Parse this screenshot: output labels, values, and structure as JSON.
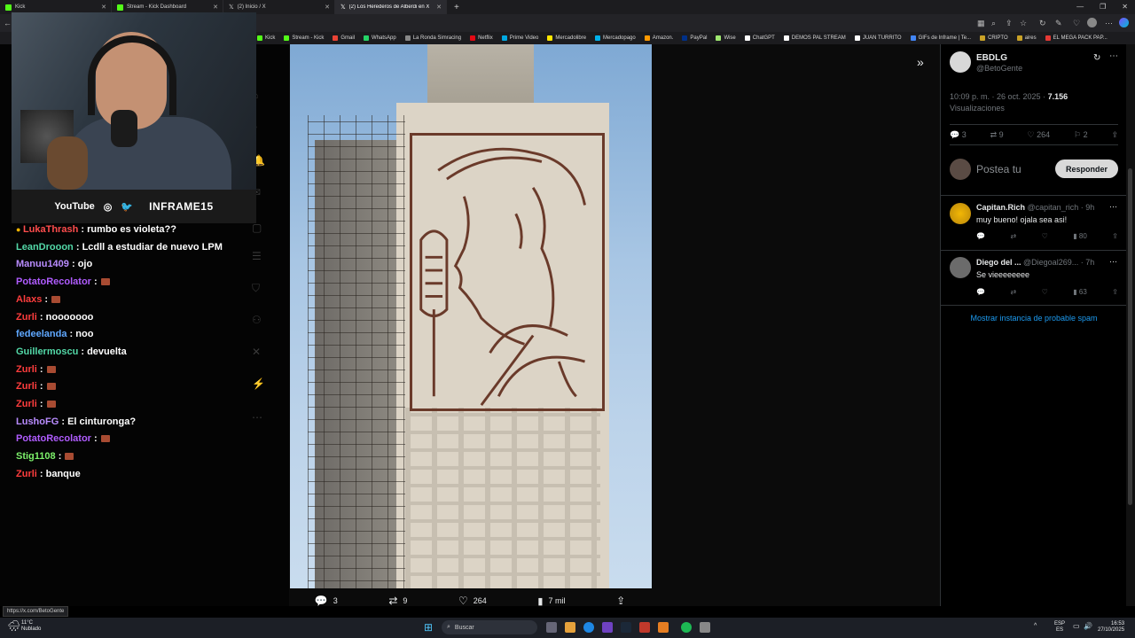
{
  "tabs": [
    {
      "label": "Kick",
      "color": "#53fc18"
    },
    {
      "label": "Stream - Kick Dashboard",
      "color": "#53fc18"
    },
    {
      "label": "(2) Inicio / X",
      "color": "#ffffff"
    },
    {
      "label": "(2) Los Herederos de Alberdi en X",
      "color": "#ffffff"
    }
  ],
  "new_tab": "+",
  "bookmarks": [
    {
      "label": "Kick",
      "color": "#53fc18"
    },
    {
      "label": "Stream - Kick",
      "color": "#53fc18"
    },
    {
      "label": "Gmail",
      "color": "#ea4335"
    },
    {
      "label": "WhatsApp",
      "color": "#25d366"
    },
    {
      "label": "La Ronda Simracing",
      "color": "#888888"
    },
    {
      "label": "Netflix",
      "color": "#e50914"
    },
    {
      "label": "Prime Video",
      "color": "#00a8e1"
    },
    {
      "label": "Mercadolibre",
      "color": "#ffe600"
    },
    {
      "label": "Mercadopago",
      "color": "#00b1ea"
    },
    {
      "label": "Amazon.",
      "color": "#ff9900"
    },
    {
      "label": "PayPal",
      "color": "#003087"
    },
    {
      "label": "Wise",
      "color": "#9fe870"
    },
    {
      "label": "ChatGPT",
      "color": "#ffffff"
    },
    {
      "label": "DEMOS PAL STREAM",
      "color": "#ffffff"
    },
    {
      "label": "JUAN TURRITO",
      "color": "#ffffff"
    },
    {
      "label": "GIFs de Inframe | Te...",
      "color": "#4285f4"
    },
    {
      "label": "CRIPTO",
      "color": "#c9a227"
    },
    {
      "label": "aires",
      "color": "#c9a227"
    },
    {
      "label": "EL MEGA PACK PAP...",
      "color": "#e53935"
    }
  ],
  "socialbar": {
    "youtube": "YouTube",
    "channel": "INFRAME15"
  },
  "chat": [
    {
      "user": "LukaThrash",
      "color": "#ff4d4d",
      "msg": ": rumbo es violeta??",
      "badge": true
    },
    {
      "user": "LeanDrooon",
      "color": "#53d9a8",
      "msg": ": Lcdll a estudiar de nuevo LPM"
    },
    {
      "user": "Manuu1409",
      "color": "#b98cff",
      "msg": ": ojo"
    },
    {
      "user": "PotatoRecolator",
      "color": "#b05cff",
      "msg": ":",
      "emote": true
    },
    {
      "user": "Alaxs",
      "color": "#ff3d3d",
      "msg": ":",
      "emote": true
    },
    {
      "user": "Zurli",
      "color": "#ff3d3d",
      "msg": ": nooooooo"
    },
    {
      "user": "fedeelanda",
      "color": "#5fa8ff",
      "msg": ": noo"
    },
    {
      "user": "Guillermoscu",
      "color": "#53d9a8",
      "msg": ": devuelta"
    },
    {
      "user": "Zurli",
      "color": "#ff3d3d",
      "msg": ":",
      "emote": true
    },
    {
      "user": "Zurli",
      "color": "#ff3d3d",
      "msg": ":",
      "emote": true
    },
    {
      "user": "Zurli",
      "color": "#ff3d3d",
      "msg": ":",
      "emote": true
    },
    {
      "user": "LushoFG",
      "color": "#b98cff",
      "msg": ": El cinturonga?"
    },
    {
      "user": "PotatoRecolator",
      "color": "#b05cff",
      "msg": ":",
      "emote": true
    },
    {
      "user": "Stig1108",
      "color": "#7cf06a",
      "msg": ":",
      "emote": true
    },
    {
      "user": "Zurli",
      "color": "#ff3d3d",
      "msg": ": banque"
    }
  ],
  "post": {
    "author_name": "EBDLG",
    "author_handle": "@BetoGente",
    "time": "10:09 p. m. · 26 oct. 2025 ·",
    "views_count": "7.156",
    "views_label": "Visualizaciones",
    "replies": "3",
    "reposts": "9",
    "likes": "264",
    "bookmarks": "2",
    "reply_placeholder": "Postea tu",
    "reply_button": "Responder"
  },
  "photo_actions": {
    "replies": "3",
    "reposts": "9",
    "likes": "264",
    "views": "7 mil"
  },
  "replies": [
    {
      "name": "Capitan.Rich",
      "handle": "@capitan_rich · 9h",
      "text": "muy bueno! ojala sea asi!",
      "views": "80"
    },
    {
      "name": "Diego del ...",
      "handle": "@Diegoal269... · 7h",
      "text": "Se vieeeeeeee",
      "views": "63"
    }
  ],
  "spam_link": "Mostrar instancia de probable spam",
  "status_url": "https://x.com/BetoGente",
  "taskbar": {
    "weather_temp": "11°C",
    "weather_desc": "Nublado",
    "search": "Buscar",
    "lang1": "ESP",
    "lang2": "ES",
    "time": "16:53",
    "date": "27/10/2025"
  }
}
